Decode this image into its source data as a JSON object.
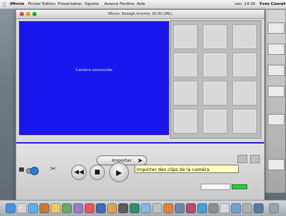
{
  "menubar": {
    "app_name": "iMovie",
    "items": [
      "Fichier",
      "Edition",
      "Présentation",
      "Signets",
      "Avancé",
      "Fenêtre",
      "Aide"
    ],
    "clock": "ven. 14:20",
    "user": "Yves Conrat"
  },
  "window": {
    "title": "iMovie: Nanagh Anomie: 00:00 (PAL)"
  },
  "viewer": {
    "status_text": "Caméra connectée"
  },
  "controls": {
    "import_button": "Importer",
    "tooltip": "Importer des clips de la caméra",
    "buttons": {
      "rewind": "◀◀",
      "stop": "■",
      "play": "▶"
    }
  },
  "colors": {
    "viewer_blue": "#1a17ee",
    "meter_green": "#32c83f"
  },
  "icons": [
    "apple-icon",
    "camera-icon",
    "scissors-icon",
    "trash-icon"
  ]
}
